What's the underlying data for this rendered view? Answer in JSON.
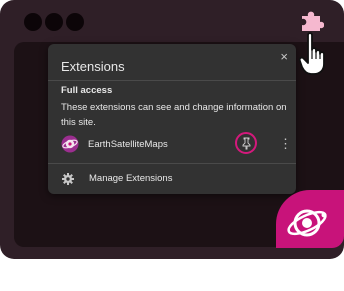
{
  "popup": {
    "title": "Extensions",
    "close_label": "×",
    "full_access_heading": "Full access",
    "full_access_description": "These extensions can see and change information on this site.",
    "extension": {
      "name": "EarthSatelliteMaps",
      "more_label": "⋮"
    },
    "manage_label": "Manage Extensions"
  },
  "icons": {
    "toolbar": "puzzle-icon",
    "cursor": "hand-cursor-icon",
    "extension": "earth-satellite-icon",
    "pin": "pin-icon",
    "settings": "gear-icon"
  },
  "colors": {
    "accent": "#d4197c",
    "window_frame": "#2f1f27",
    "popup_background": "#323232",
    "puzzle": "#f5b8cf"
  }
}
